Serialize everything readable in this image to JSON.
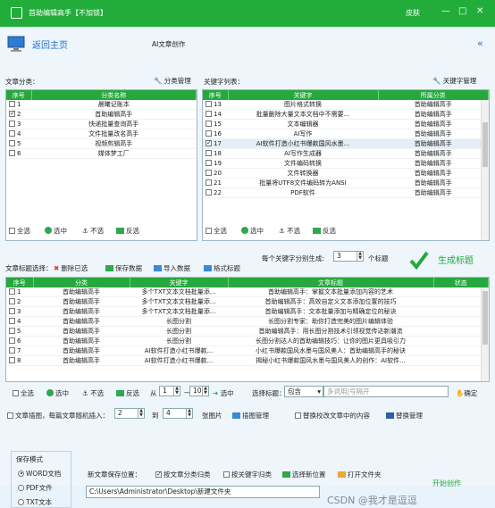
{
  "window": {
    "title": "首助编辑高手【不加锁】",
    "skin": "皮肤",
    "min": "—",
    "max": "□",
    "close": "✕"
  },
  "nav": {
    "back": "返回主页",
    "sub": "AI文章创作",
    "collapse": "«"
  },
  "cat": {
    "label": "文章分类：",
    "manage": "分类管理",
    "headers": [
      "序号",
      "分类名称"
    ],
    "rows": [
      {
        "n": "1",
        "name": "晨曦记账本",
        "on": false
      },
      {
        "n": "2",
        "name": "首助编辑高手",
        "on": true
      },
      {
        "n": "3",
        "name": "快递批量查询高手",
        "on": false
      },
      {
        "n": "4",
        "name": "文件批量改名高手",
        "on": false
      },
      {
        "n": "5",
        "name": "视频剪辑高手",
        "on": false
      },
      {
        "n": "6",
        "name": "媒体梦工厂",
        "on": false
      }
    ]
  },
  "kw": {
    "label": "关键字列表：",
    "manage": "关键字管理",
    "headers": [
      "序号",
      "关键字",
      "所属分类"
    ],
    "rows": [
      {
        "n": "13",
        "k": "图片格式转换",
        "c": "首助编辑高手",
        "on": false
      },
      {
        "n": "14",
        "k": "批量删除大量文本文档中不需要...",
        "c": "首助编辑高手",
        "on": false
      },
      {
        "n": "15",
        "k": "文本编辑器",
        "c": "首助编辑高手",
        "on": false
      },
      {
        "n": "16",
        "k": "AI写作",
        "c": "首助编辑高手",
        "on": false
      },
      {
        "n": "17",
        "k": "AI软件打造小红书爆款国风水墨...",
        "c": "首助编辑高手",
        "on": true
      },
      {
        "n": "18",
        "k": "AI写作生成器",
        "c": "首助编辑高手",
        "on": false
      },
      {
        "n": "19",
        "k": "文件编码转换",
        "c": "首助编辑高手",
        "on": false
      },
      {
        "n": "20",
        "k": "文件转换器",
        "c": "首助编辑高手",
        "on": false
      },
      {
        "n": "21",
        "k": "批量将UTF8文件编码转为ANSI",
        "c": "首助编辑高手",
        "on": false
      },
      {
        "n": "22",
        "k": "PDF软件",
        "c": "首助编辑高手",
        "on": false
      }
    ]
  },
  "sel_actions": {
    "all": "全选",
    "selected": "选中",
    "none": "不选",
    "invert": "反选"
  },
  "titles_bar": {
    "label": "文章标题选择：",
    "delete": "删除已选",
    "save": "保存数据",
    "import": "导入数据",
    "format": "格式标题",
    "per_kw_pre": "每个关键字分别生成:",
    "per_kw_val": "3",
    "per_kw_suf": "个标题",
    "generate": "生成标题"
  },
  "titles": {
    "headers": [
      "序号",
      "分类",
      "关键字",
      "文章标题",
      "状态"
    ],
    "rows": [
      {
        "n": "1",
        "c": "首助编辑高手",
        "k": "多个TXT文本文档批量添...",
        "t": "首助编辑高手：掌握文本批量添加内容的艺术"
      },
      {
        "n": "2",
        "c": "首助编辑高手",
        "k": "多个TXT文本文档批量添...",
        "t": "首助编辑高手：高效自定义文本添加位置的技巧"
      },
      {
        "n": "3",
        "c": "首助编辑高手",
        "k": "多个TXT文本文档批量添...",
        "t": "首助编辑高手：文本批量添加与精确定位的秘诀"
      },
      {
        "n": "4",
        "c": "首助编辑高手",
        "k": "长图分割",
        "t": "长图分割专家：助你打造完美的图片编辑体验"
      },
      {
        "n": "5",
        "c": "首助编辑高手",
        "k": "长图分割",
        "t": "首助编辑高手：用长图分割技术引领视觉传达新潮流"
      },
      {
        "n": "6",
        "c": "首助编辑高手",
        "k": "长图分割",
        "t": "长图分割达人的首助编辑技巧：让你的图片更具吸引力"
      },
      {
        "n": "7",
        "c": "首助编辑高手",
        "k": "AI软件打造小红书爆款...",
        "t": "小红书爆款国风水墨与国风美人：首助编辑高手的秘诀"
      },
      {
        "n": "8",
        "c": "首助编辑高手",
        "k": "AI软件打造小红书爆款...",
        "t": "揭秘小红书爆款国风水墨与国风美人的创作：AI软件..."
      }
    ]
  },
  "range": {
    "from_label": "从",
    "from": "1",
    "dash": "—",
    "to": "10",
    "selected": "选中",
    "pick_label": "选择标题：",
    "pick_value": "包含",
    "placeholder": "多词用|号隔开",
    "confirm": "确定"
  },
  "insert": {
    "label": "文章插图，每篇文章随机插入：",
    "min": "2",
    "to": "到",
    "max": "4",
    "suffix": "张图片",
    "img_manage": "插图管理",
    "replace_label": "替换校改文章中的内容",
    "replace_manage": "替换管理"
  },
  "save": {
    "legend": "保存模式",
    "modes": [
      "WORD文档",
      "PDF文件",
      "TXT文本"
    ],
    "selected": 0,
    "path_label": "新文章保存位置：",
    "opt1": "按文章分类归类",
    "opt1_on": true,
    "opt2": "按关键字归类",
    "opt2_on": false,
    "choose": "选择新位置",
    "open": "打开文件夹",
    "path": "C:\\Users\\Administrator\\Desktop\\新建文件夹",
    "start": "开始创作"
  },
  "watermark": "CSDN @我才是逗逗"
}
